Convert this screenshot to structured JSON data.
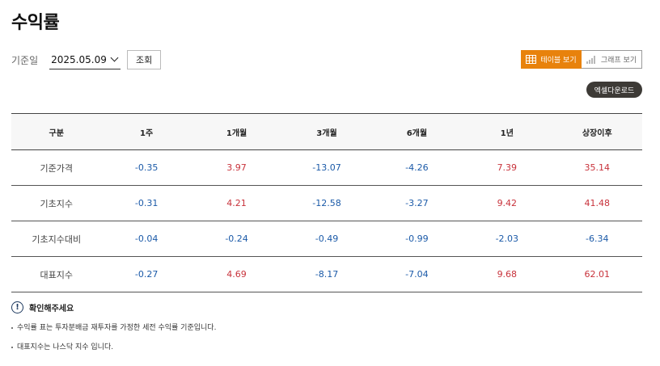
{
  "page": {
    "title": "수익률"
  },
  "filter": {
    "label": "기준일",
    "date_value": "2025.05.09",
    "search_label": "조회"
  },
  "view_toggle": {
    "table_label": "테이블 보기",
    "graph_label": "그래프 보기",
    "active": "table"
  },
  "excel_download_label": "엑셀다운로드",
  "table": {
    "headers": [
      "구분",
      "1주",
      "1개월",
      "3개월",
      "6개월",
      "1년",
      "상장이후"
    ],
    "rows": [
      {
        "label": "기준가격",
        "values": [
          "-0.35",
          "3.97",
          "-13.07",
          "-4.26",
          "7.39",
          "35.14"
        ]
      },
      {
        "label": "기초지수",
        "values": [
          "-0.31",
          "4.21",
          "-12.58",
          "-3.27",
          "9.42",
          "41.48"
        ]
      },
      {
        "label": "기초지수대비",
        "values": [
          "-0.04",
          "-0.24",
          "-0.49",
          "-0.99",
          "-2.03",
          "-6.34"
        ]
      },
      {
        "label": "대표지수",
        "values": [
          "-0.27",
          "4.69",
          "-8.17",
          "-7.04",
          "9.68",
          "62.01"
        ]
      }
    ]
  },
  "notice": {
    "title": "확인해주세요",
    "icon": "info-icon",
    "items": [
      "수익률 표는 투자분배금 재투자를 가정한 세전 수익률 기준입니다.",
      "대표지수는 나스닥 지수 입니다."
    ]
  },
  "colors": {
    "accent": "#e8820c",
    "negative": "#1b5aa8",
    "positive": "#c8323b",
    "dark_button": "#3d3a36"
  }
}
